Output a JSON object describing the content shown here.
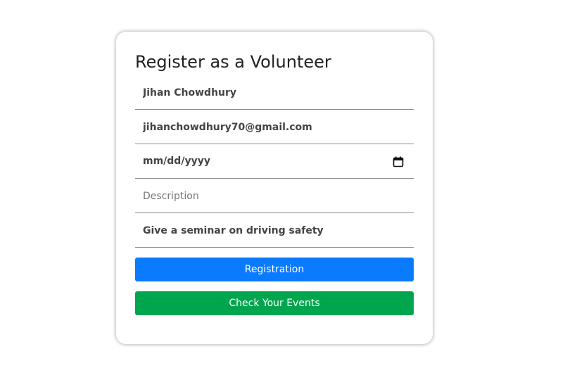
{
  "form": {
    "title": "Register as a Volunteer",
    "name_value": "Jihan Chowdhury",
    "email_value": "jihanchowdhury70@gmail.com",
    "date_placeholder": "mm/dd/yyyy",
    "description_placeholder": "Description",
    "event_value": "Give a seminar on driving safety",
    "registration_label": "Registration",
    "check_events_label": "Check Your Events"
  },
  "colors": {
    "primary": "#0a7bff",
    "success": "#00a64e"
  },
  "icons": {
    "date": "calendar-icon"
  }
}
